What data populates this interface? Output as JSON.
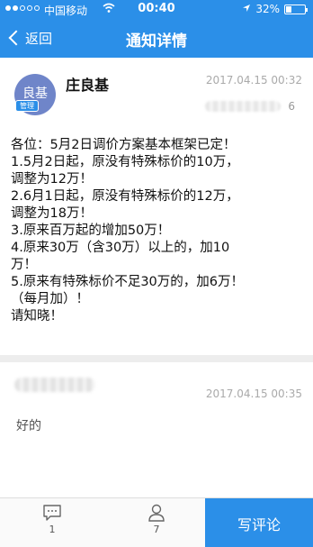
{
  "status_bar": {
    "carrier": "中国移动",
    "time": "00:40",
    "battery": "32%",
    "battery_level": 0.32,
    "icons": [
      "signal-icon",
      "wifi-icon",
      "location-arrow-icon",
      "battery-icon"
    ]
  },
  "nav": {
    "back_label": "返回",
    "title": "通知详情"
  },
  "notice": {
    "avatar_text": "良基",
    "badge": "管理",
    "author": "庄良基",
    "time": "2017.04.15 00:32",
    "blurred_digit": "6",
    "body_lines": [
      "各位：5月2日调价方案基本框架已定！",
      "1.5月2日起，原没有特殊标价的10万，",
      "调整为12万！",
      "2.6月1日起，原没有特殊标价的12万，",
      "调整为18万！",
      "3.原来百万起的增加50万！",
      "4.原来30万（含30万）以上的，加10",
      "万！",
      "5.原来有特殊标价不足30万的，加6万！",
      "（每月加）！",
      "请知晓！"
    ]
  },
  "comment": {
    "time": "2017.04.15 00:35",
    "text": "好的"
  },
  "bottom_bar": {
    "comment_count": "1",
    "read_count": "7",
    "write_comment_label": "写评论"
  },
  "colors": {
    "accent": "#2b8fe8",
    "avatar": "#6f85c9"
  }
}
